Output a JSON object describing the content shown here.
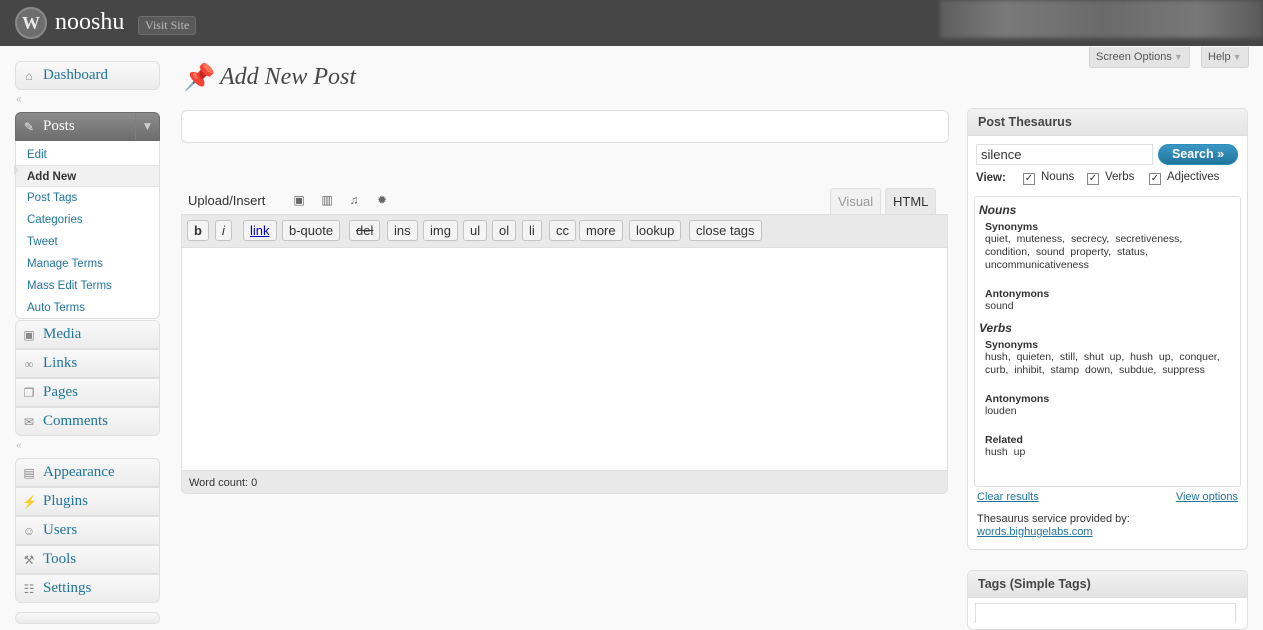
{
  "header": {
    "site_title": "nooshu",
    "visit_site": "Visit Site"
  },
  "screen_meta": {
    "screen_options": "Screen Options",
    "help": "Help"
  },
  "menu": {
    "dashboard": "Dashboard",
    "posts": "Posts",
    "posts_sub": [
      "Edit",
      "Add New",
      "Post Tags",
      "Categories",
      "Tweet",
      "Manage Terms",
      "Mass Edit Terms",
      "Auto Terms"
    ],
    "media": "Media",
    "links": "Links",
    "pages": "Pages",
    "comments": "Comments",
    "appearance": "Appearance",
    "plugins": "Plugins",
    "users": "Users",
    "tools": "Tools",
    "settings": "Settings"
  },
  "main": {
    "page_title": "Add New Post",
    "title_value": "",
    "upload_insert": "Upload/Insert",
    "tab_visual": "Visual",
    "tab_html": "HTML",
    "quicktags": [
      "b",
      "i",
      "link",
      "b-quote",
      "del",
      "ins",
      "img",
      "ul",
      "ol",
      "li",
      "cc",
      "more",
      "lookup",
      "close tags"
    ],
    "word_count": "Word count: 0"
  },
  "thesaurus": {
    "title": "Post Thesaurus",
    "query": "silence",
    "search_label": "Search »",
    "view_label": "View:",
    "options": [
      "Nouns",
      "Verbs",
      "Adjectives"
    ],
    "nouns_heading": "Nouns",
    "nouns_syn_label": "Synonyms",
    "nouns_syn": "quiet, muteness, secrecy, secretiveness, condition, sound property, status, uncommunicativeness",
    "nouns_ant_label": "Antonymons",
    "nouns_ant": "sound",
    "verbs_heading": "Verbs",
    "verbs_syn_label": "Synonyms",
    "verbs_syn": "hush, quieten, still, shut up, hush up, conquer, curb, inhibit, stamp down, subdue, suppress",
    "verbs_ant_label": "Antonymons",
    "verbs_ant": "louden",
    "verbs_rel_label": "Related",
    "verbs_rel": "hush up",
    "clear_results": "Clear results",
    "view_options": "View options",
    "provided_by": "Thesaurus service provided by:",
    "provider": "words.bighugelabs.com"
  },
  "tags_box": {
    "title": "Tags (Simple Tags)"
  },
  "colors": {
    "header_bg": "#464646",
    "link": "#21759b",
    "button_blue": "#21759b"
  }
}
